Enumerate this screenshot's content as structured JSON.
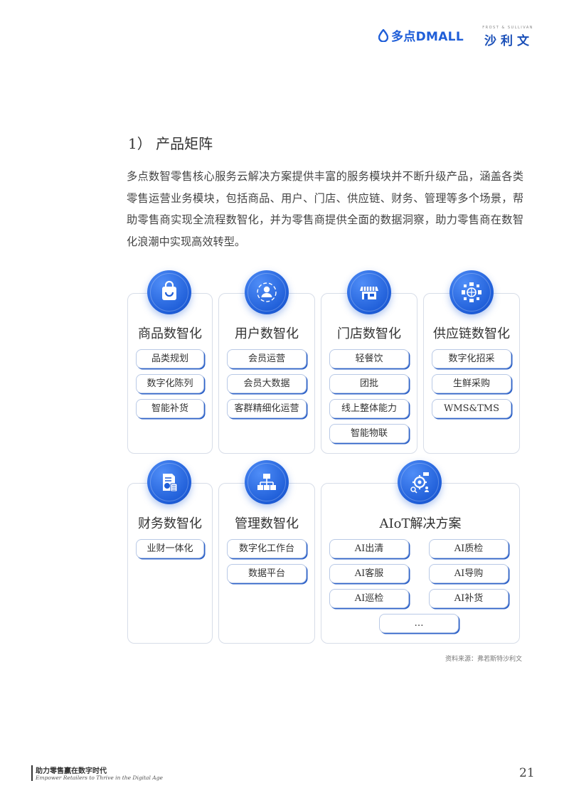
{
  "header": {
    "dmall_logo_text": "多点DMALL",
    "frost_logo_small": "FROST & SULLIVAN",
    "frost_logo_text": "沙利文"
  },
  "section_title": "1） 产品矩阵",
  "intro": "多点数智零售核心服务云解决方案提供丰富的服务模块并不断升级产品，涵盖各类零售运营业务模块，包括商品、用户、门店、供应链、财务、管理等多个场景，帮助零售商实现全流程数智化，并为零售商提供全面的数据洞察，助力零售商在数智化浪潮中实现高效转型。",
  "cards": [
    {
      "title": "商品数智化",
      "icon": "shopping-bag-icon",
      "items": [
        "品类规划",
        "数字化陈列",
        "智能补货"
      ]
    },
    {
      "title": "用户数智化",
      "icon": "user-icon",
      "items": [
        "会员运营",
        "会员大数据",
        "客群精细化运营"
      ]
    },
    {
      "title": "门店数智化",
      "icon": "store-icon",
      "items": [
        "轻餐饮",
        "团批",
        "线上整体能力",
        "智能物联"
      ]
    },
    {
      "title": "供应链数智化",
      "icon": "supply-chain-icon",
      "items": [
        "数字化招采",
        "生鲜采购",
        "WMS&TMS"
      ]
    },
    {
      "title": "财务数智化",
      "icon": "finance-icon",
      "items": [
        "业财一体化"
      ]
    },
    {
      "title": "管理数智化",
      "icon": "org-chart-icon",
      "items": [
        "数字化工作台",
        "数据平台"
      ]
    },
    {
      "title": "AIoT解决方案",
      "icon": "aiot-icon",
      "items": [
        "AI出清",
        "AI质检",
        "AI客服",
        "AI导购",
        "AI巡检",
        "AI补货",
        "…"
      ]
    }
  ],
  "source": "资料来源：弗若斯特沙利文",
  "footer": {
    "cn": "助力零售赢在数字时代",
    "en": "Empower Retailers to Thrive in the Digital Age",
    "page": "21"
  },
  "colors": {
    "brand_blue": "#1f5ed8",
    "border": "#d7dde8",
    "text": "#333333"
  }
}
